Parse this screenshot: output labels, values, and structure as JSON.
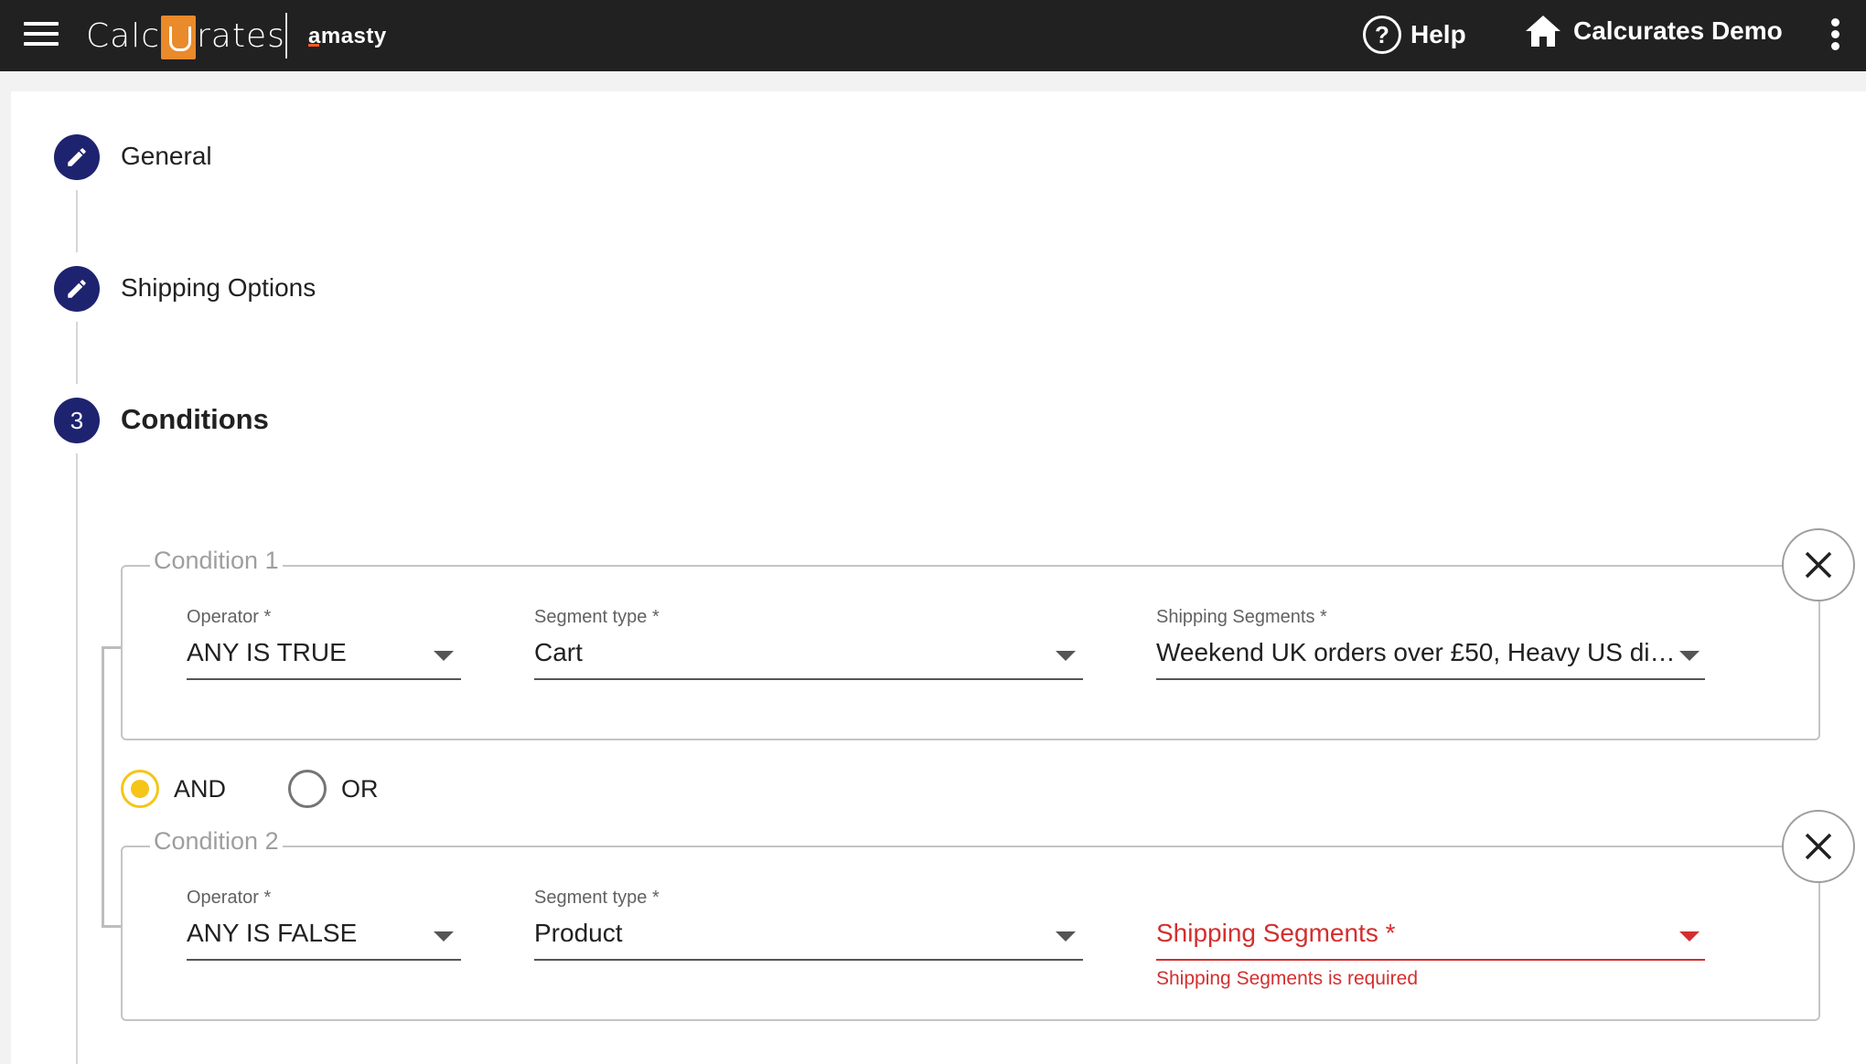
{
  "header": {
    "logo_text_left": "Calc",
    "logo_text_right": "rates",
    "partner_brand": "amasty",
    "help_label": "Help",
    "store_name": "Calcurates Demo"
  },
  "stepper": {
    "steps": [
      {
        "number": "",
        "label": "General",
        "state": "edit"
      },
      {
        "number": "",
        "label": "Shipping Options",
        "state": "edit"
      },
      {
        "number": "3",
        "label": "Conditions",
        "state": "active"
      }
    ]
  },
  "conditions": [
    {
      "legend": "Condition 1",
      "operator_label": "Operator *",
      "operator_value": "ANY IS TRUE",
      "segment_type_label": "Segment type *",
      "segment_type_value": "Cart",
      "segments_label": "Shipping Segments *",
      "segments_value": "Weekend UK orders over £50, Heavy US dist...",
      "error": ""
    },
    {
      "legend": "Condition 2",
      "operator_label": "Operator *",
      "operator_value": "ANY IS FALSE",
      "segment_type_label": "Segment type *",
      "segment_type_value": "Product",
      "segments_label": "",
      "segments_value": "Shipping Segments *",
      "error": "Shipping Segments is required"
    }
  ],
  "logic": {
    "and_label": "AND",
    "or_label": "OR",
    "selected": "AND"
  },
  "colors": {
    "topbar": "#212121",
    "step_dot": "#1e2370",
    "radio_accent": "#f5c518",
    "error": "#d32f2f",
    "logo_accent": "#e98a2b"
  }
}
